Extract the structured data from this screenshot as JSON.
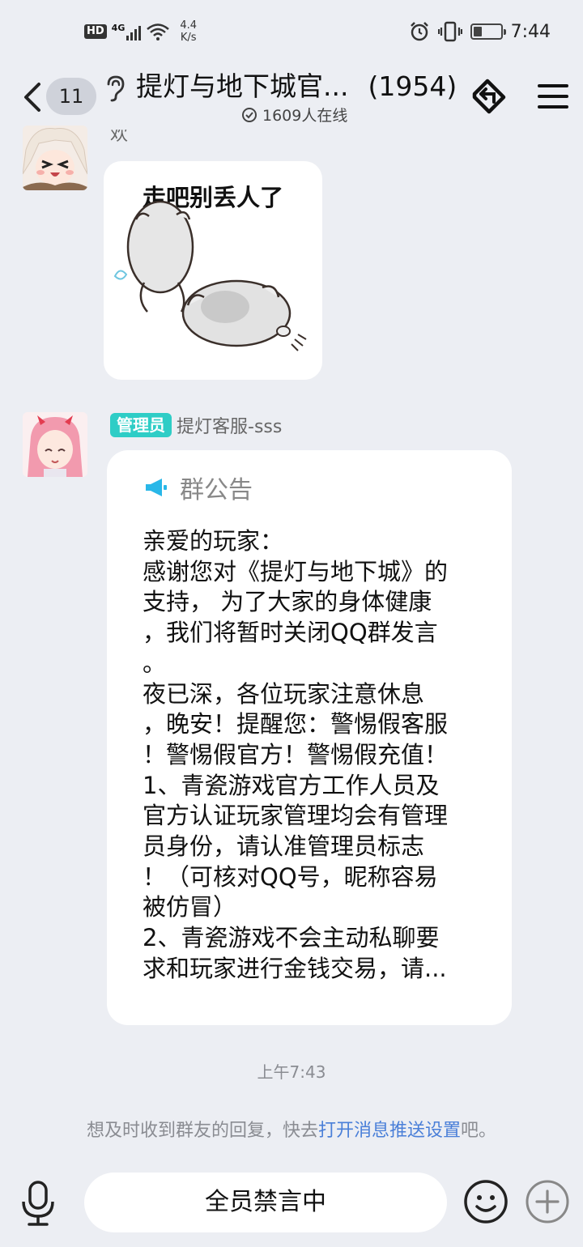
{
  "status": {
    "hd": "HD",
    "net": "4G",
    "speed_value": "4.4",
    "speed_unit": "K/s",
    "time": "7:44",
    "battery_level": 0.3,
    "icons": [
      "alarm-icon",
      "vibrate-icon",
      "battery-icon",
      "wifi-icon",
      "signal-icon"
    ]
  },
  "header": {
    "back_icon": "chevron-left-icon",
    "unread_count": "11",
    "ear_icon": "earpiece-icon",
    "title": "提灯与地下城官...",
    "member_count": "(1954)",
    "online_text": "1609人在线",
    "share_icon": "share-icon",
    "menu_icon": "menu-icon"
  },
  "messages": [
    {
      "nickname_cut": "欢",
      "sticker_text": "走吧别丢人了"
    },
    {
      "role_tag": "管理员",
      "nickname": "提灯客服-sss",
      "notice_title": "群公告",
      "notice_lines": [
        "亲爱的玩家：",
        "感谢您对《提灯与地下城》的",
        "支持， 为了大家的身体健康",
        "，我们将暂时关闭QQ群发言",
        "。",
        "夜已深，各位玩家注意休息",
        "，晚安！提醒您：警惕假客服",
        "！警惕假官方！警惕假充值！",
        "1、青瓷游戏官方工作人员及",
        "官方认证玩家管理均会有管理",
        "员身份，请认准管理员标志",
        "！（可核对QQ号，昵称容易",
        "被仿冒）",
        "2、青瓷游戏不会主动私聊要",
        "求和玩家进行金钱交易，请..."
      ]
    }
  ],
  "timestamp": "上午7:43",
  "tip": {
    "prefix": "想及时收到群友的回复，快去",
    "link": "打开消息推送设置",
    "suffix": "吧。"
  },
  "input": {
    "muted_text": "全员禁言中"
  },
  "colors": {
    "background": "#eceef3",
    "admin_tag": "#2ecdc6",
    "link": "#4a7fd8",
    "announcement_icon": "#29b7e8"
  }
}
